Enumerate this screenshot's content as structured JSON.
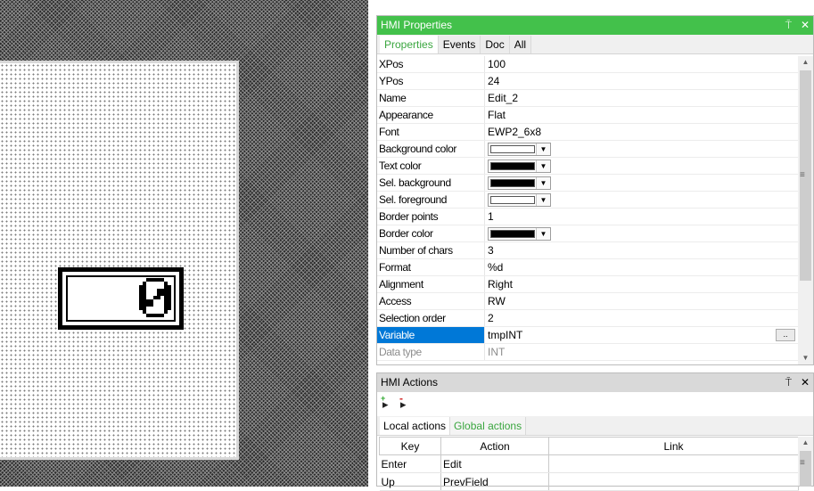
{
  "canvas": {
    "widget_glyph": "0"
  },
  "properties_panel": {
    "title": "HMI Properties",
    "pin": "⍑",
    "close": "✕",
    "tabs": [
      "Properties",
      "Events",
      "Doc",
      "All"
    ],
    "rows": [
      {
        "name": "XPos",
        "value": "100"
      },
      {
        "name": "YPos",
        "value": "24"
      },
      {
        "name": "Name",
        "value": "Edit_2"
      },
      {
        "name": "Appearance",
        "value": "Flat"
      },
      {
        "name": "Font",
        "value": "EWP2_6x8"
      },
      {
        "name": "Background color",
        "value": "",
        "color": "#ffffff"
      },
      {
        "name": "Text color",
        "value": "",
        "color": "#000000"
      },
      {
        "name": "Sel. background",
        "value": "",
        "color": "#000000"
      },
      {
        "name": "Sel. foreground",
        "value": "",
        "color": "#ffffff"
      },
      {
        "name": "Border points",
        "value": "1"
      },
      {
        "name": "Border color",
        "value": "",
        "color": "#000000"
      },
      {
        "name": "Number of chars",
        "value": "3"
      },
      {
        "name": "Format",
        "value": "%d"
      },
      {
        "name": "Alignment",
        "value": "Right"
      },
      {
        "name": "Access",
        "value": "RW"
      },
      {
        "name": "Selection order",
        "value": "2"
      },
      {
        "name": "Variable",
        "value": "tmpINT",
        "button": ".."
      },
      {
        "name": "Data type",
        "value": "INT"
      }
    ]
  },
  "actions_panel": {
    "title": "HMI Actions",
    "pin": "⍑",
    "close": "✕",
    "tool_add_icon": "add-action-icon",
    "tool_remove_icon": "remove-action-icon",
    "tabs": [
      "Local actions",
      "Global actions"
    ],
    "columns": [
      "Key",
      "Action",
      "Link"
    ],
    "rows": [
      {
        "key": "Enter",
        "action": "Edit",
        "link": ""
      },
      {
        "key": "Up",
        "action": "PrevField",
        "link": ""
      }
    ]
  },
  "colors": {
    "accent": "#43c14b",
    "selection": "#0078d7"
  }
}
